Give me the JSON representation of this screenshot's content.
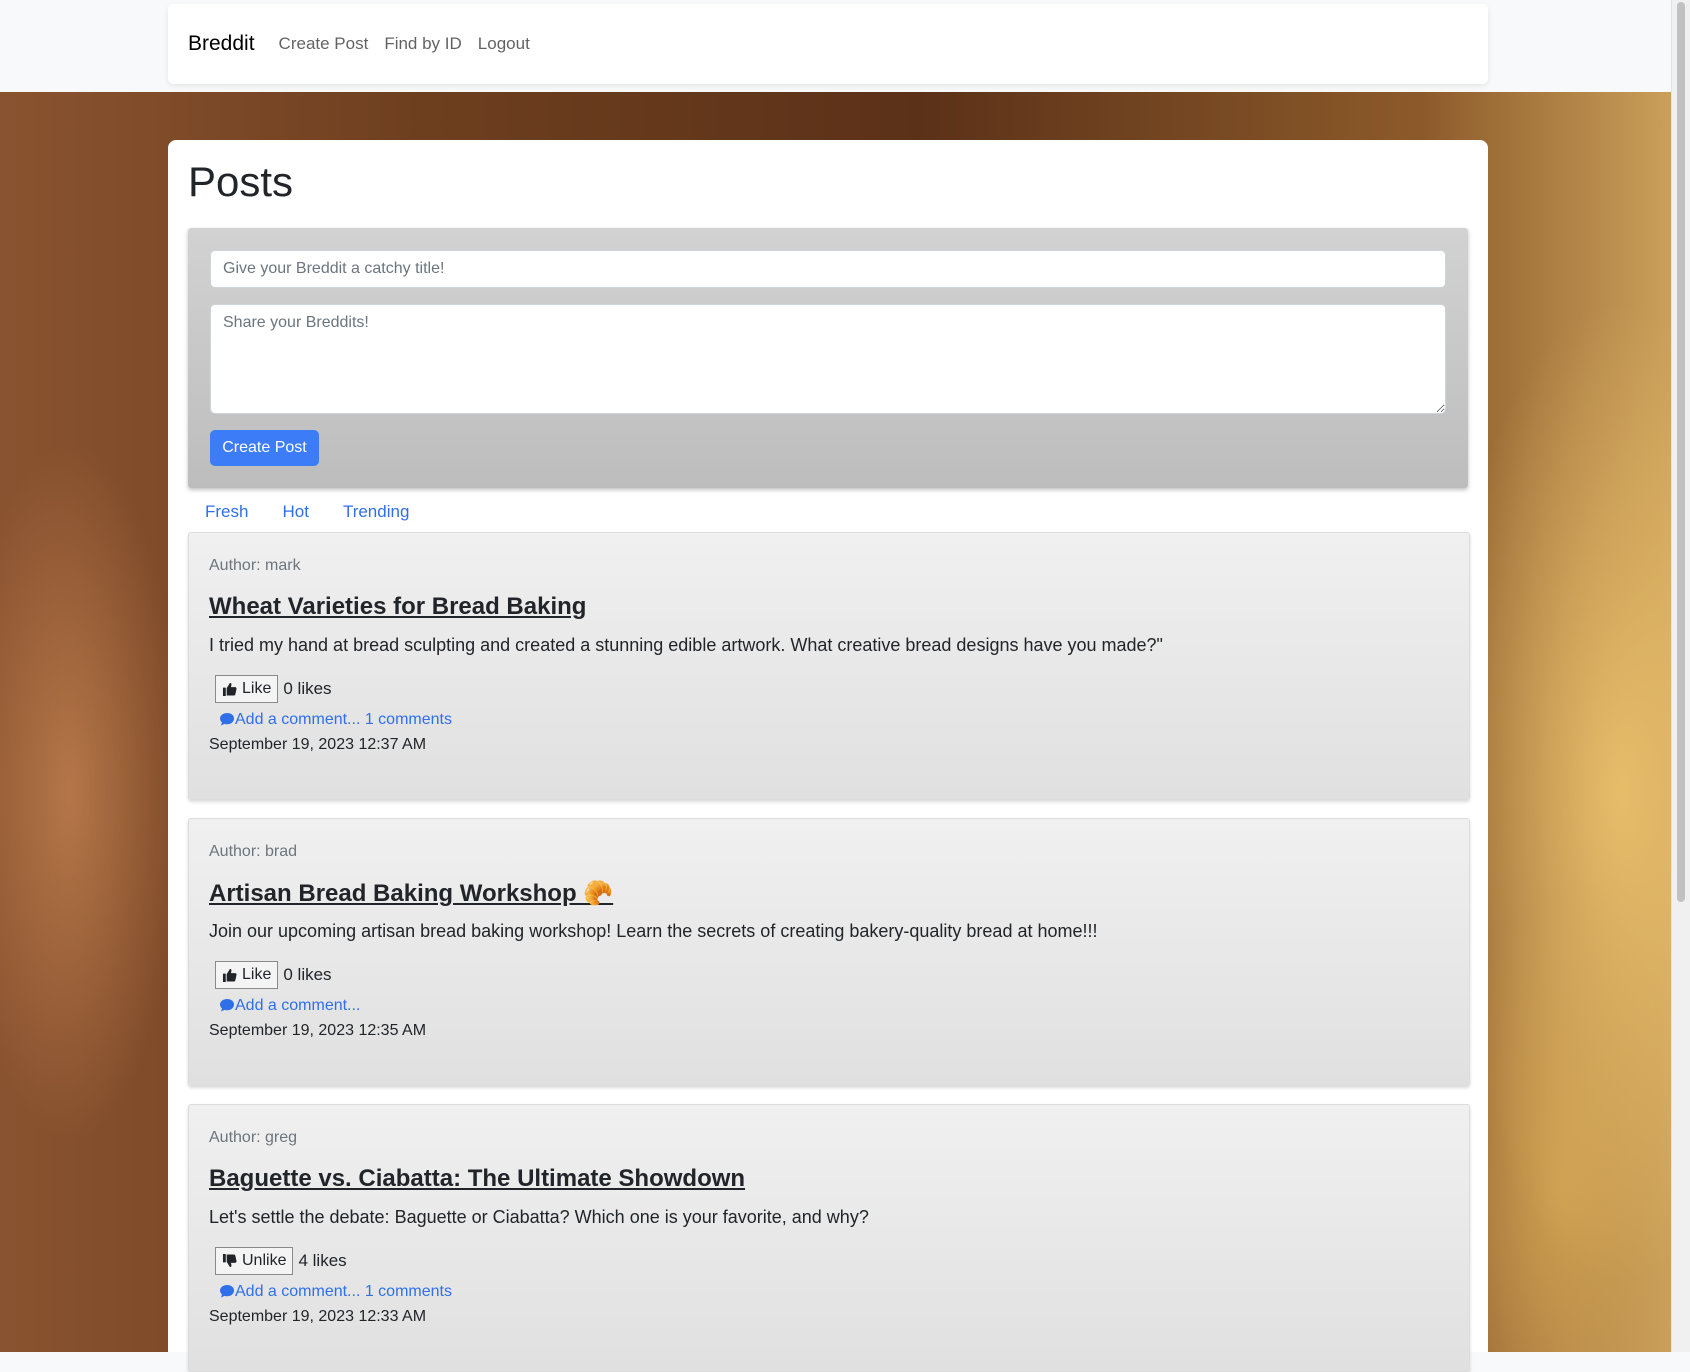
{
  "nav": {
    "brand": "Breddit",
    "links": [
      "Create Post",
      "Find by ID",
      "Logout"
    ]
  },
  "page": {
    "title": "Posts"
  },
  "form": {
    "title_placeholder": "Give your Breddit a catchy title!",
    "body_placeholder": "Share your Breddits!",
    "submit_label": "Create Post"
  },
  "tabs": [
    "Fresh",
    "Hot",
    "Trending"
  ],
  "colors": {
    "accent": "#3d7cf7",
    "link": "#2f6fe8"
  },
  "posts": [
    {
      "author": "Author: mark",
      "title": "Wheat Varieties for Bread Baking",
      "body": "I tried my hand at bread sculpting and created a stunning edible artwork. What creative bread designs have you made?\"",
      "like_label": "Like",
      "like_icon": "thumbs-up-icon",
      "likes": "0 likes",
      "comment_link": "Add a comment...",
      "comments_count": " 1 comments",
      "date": "September 19, 2023 12:37 AM"
    },
    {
      "author": "Author: brad",
      "title": "Artisan Bread Baking Workshop 🥐",
      "body": "Join our upcoming artisan bread baking workshop! Learn the secrets of creating bakery-quality bread at home!!!",
      "like_label": "Like",
      "like_icon": "thumbs-up-icon",
      "likes": "0 likes",
      "comment_link": "Add a comment...",
      "comments_count": "",
      "date": "September 19, 2023 12:35 AM"
    },
    {
      "author": "Author: greg",
      "title": "Baguette vs. Ciabatta: The Ultimate Showdown",
      "body": "Let's settle the debate: Baguette or Ciabatta? Which one is your favorite, and why?",
      "like_label": "Unlike",
      "like_icon": "thumbs-down-icon",
      "likes": "4 likes",
      "comment_link": "Add a comment...",
      "comments_count": " 1 comments",
      "date": "September 19, 2023 12:33 AM"
    }
  ]
}
